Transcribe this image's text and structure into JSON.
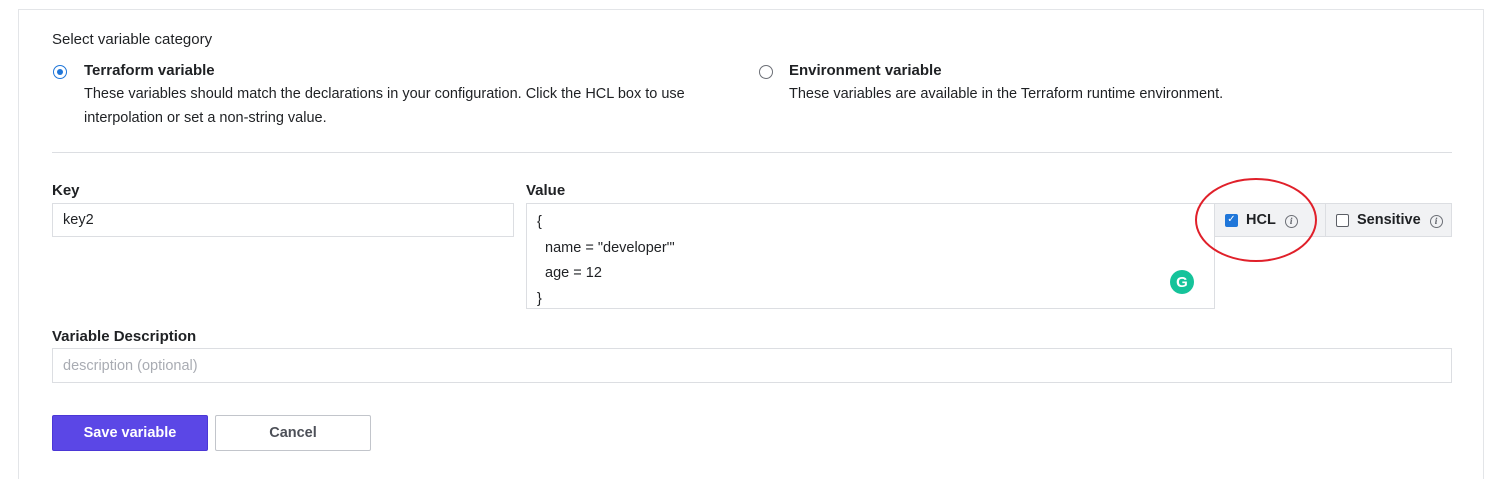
{
  "category": {
    "title": "Select variable category",
    "options": [
      {
        "label": "Terraform variable",
        "desc_line1": "These variables should match the declarations in your configuration. Click the HCL box to use",
        "desc_line2": "interpolation or set a non-string value.",
        "selected": true
      },
      {
        "label": "Environment variable",
        "desc_line1": "These variables are available in the Terraform runtime environment.",
        "selected": false
      }
    ]
  },
  "key": {
    "label": "Key",
    "value": "key2"
  },
  "value": {
    "label": "Value",
    "text": "{\n  name = \"developer'\"\n  age = 12\n}"
  },
  "options": {
    "hcl_label": "HCL",
    "hcl_checked": true,
    "sensitive_label": "Sensitive",
    "sensitive_checked": false
  },
  "description": {
    "label": "Variable Description",
    "placeholder": "description (optional)",
    "value": ""
  },
  "buttons": {
    "save": "Save variable",
    "cancel": "Cancel"
  },
  "grammarly": {
    "glyph": "G"
  },
  "icons": {
    "info": "i",
    "check": "✓"
  },
  "colors": {
    "primary": "#5b47e6",
    "radio_selected": "#1f76d9",
    "highlight": "#e0202a",
    "grammarly": "#15c39a"
  }
}
